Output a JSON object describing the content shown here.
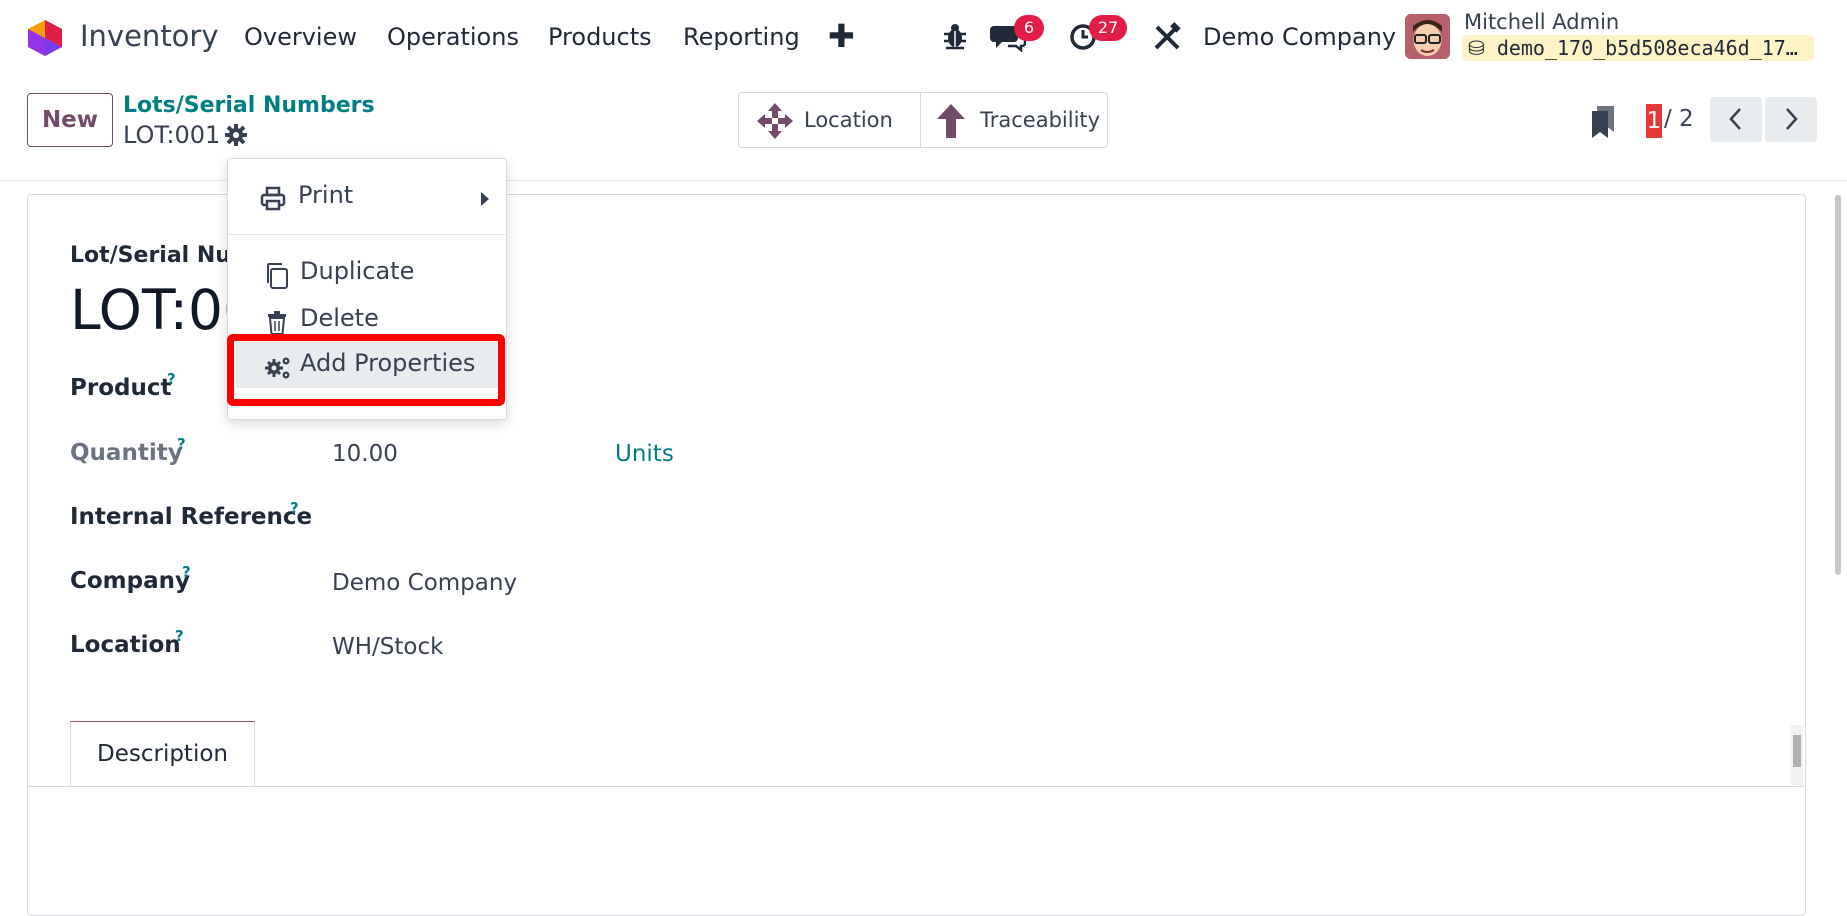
{
  "nav": {
    "app_name": "Inventory",
    "menu": [
      "Overview",
      "Operations",
      "Products",
      "Reporting"
    ],
    "messages_count": "6",
    "activities_count": "27",
    "company": "Demo Company",
    "user_name": "Mitchell Admin",
    "database": "demo_170_b5d508eca46d_17…"
  },
  "control_panel": {
    "new_label": "New",
    "breadcrumb": "Lots/Serial Numbers",
    "record_name": "LOT:001",
    "smart_buttons": [
      "Location",
      "Traceability"
    ],
    "pager_current": "1",
    "pager_total": "/ 2"
  },
  "gear_menu": {
    "items": [
      "Print",
      "Duplicate",
      "Delete",
      "Add Properties"
    ]
  },
  "form": {
    "title_label": "Lot/Serial Nur",
    "name": "LOT:00",
    "fields": {
      "product_label": "Product",
      "quantity_label": "Quantity",
      "quantity_value": "10.00",
      "quantity_unit": "Units",
      "internal_ref_label": "Internal Reference",
      "company_label": "Company",
      "company_value": "Demo Company",
      "location_label": "Location",
      "location_value": "WH/Stock"
    },
    "help_mark": "?",
    "tabs": [
      "Description"
    ]
  },
  "colors": {
    "brand": "#714b67",
    "link": "#017e84",
    "badge": "#e11d48",
    "highlight": "#ff0000"
  }
}
